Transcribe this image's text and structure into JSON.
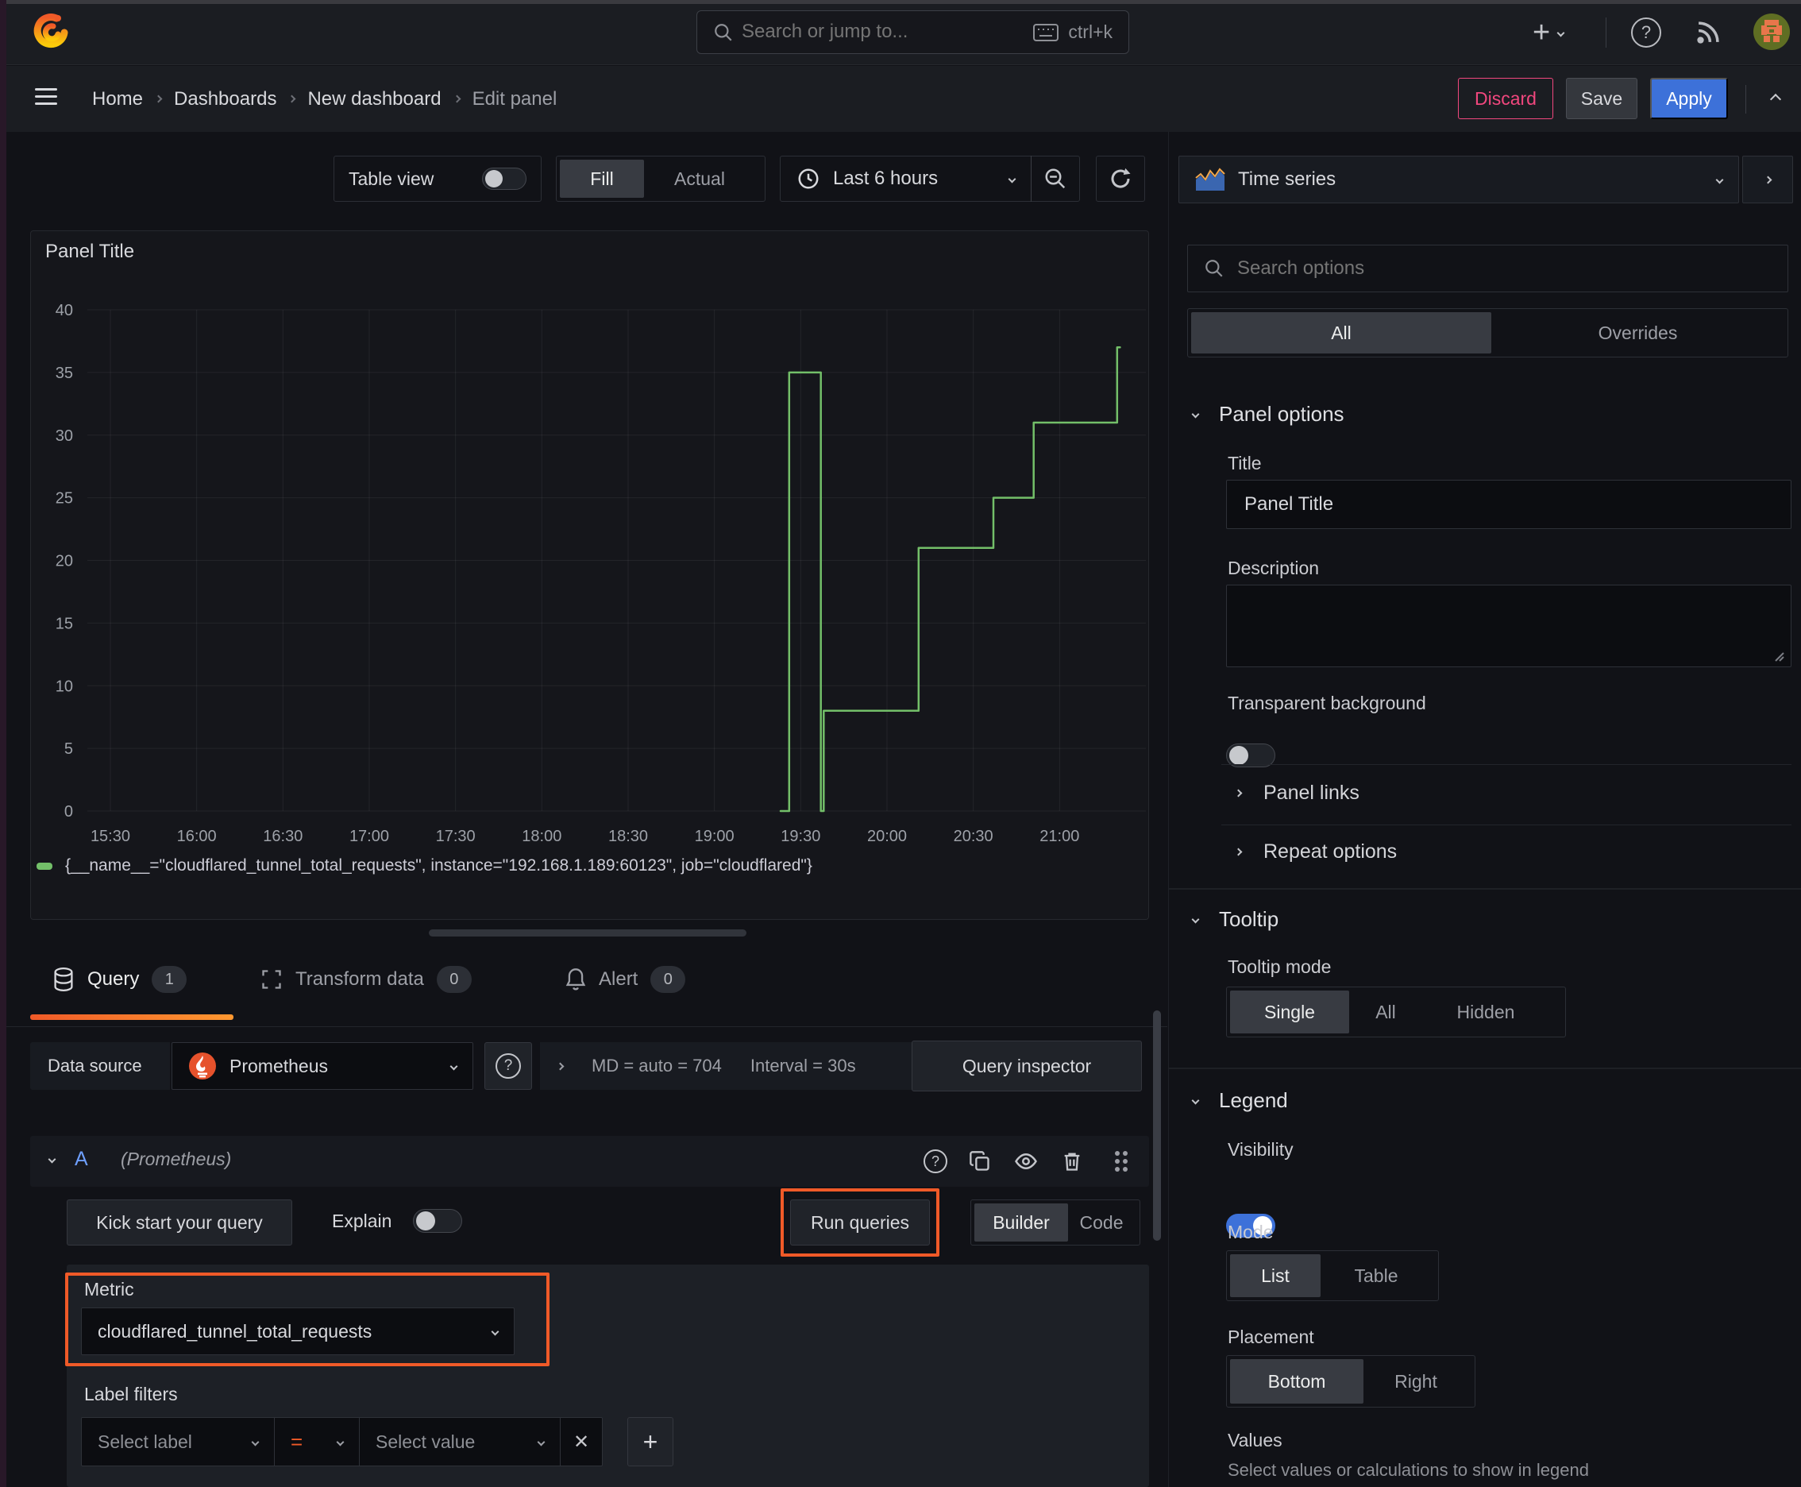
{
  "topnav": {
    "search_placeholder": "Search or jump to...",
    "shortcut": "ctrl+k"
  },
  "breadcrumb": {
    "items": [
      "Home",
      "Dashboards",
      "New dashboard",
      "Edit panel"
    ],
    "discard": "Discard",
    "save": "Save",
    "apply": "Apply"
  },
  "toolbar": {
    "table_view": "Table view",
    "fill": "Fill",
    "actual": "Actual",
    "time_range": "Last 6 hours"
  },
  "panel": {
    "title": "Panel Title"
  },
  "chart_data": {
    "type": "line",
    "title": "Panel Title",
    "x_ticks": [
      "15:30",
      "16:00",
      "16:30",
      "17:00",
      "17:30",
      "18:00",
      "18:30",
      "19:00",
      "19:30",
      "20:00",
      "20:30",
      "21:00"
    ],
    "y_ticks": [
      0,
      5,
      10,
      15,
      20,
      25,
      30,
      35,
      40
    ],
    "ylim": [
      0,
      40
    ],
    "x_domain_minutes_from_1530": [
      -8,
      360
    ],
    "grid": true,
    "legend_position": "bottom",
    "series": [
      {
        "name": "{__name__=\"cloudflared_tunnel_total_requests\", instance=\"192.168.1.189:60123\", job=\"cloudflared\"}",
        "color": "#73bf69",
        "points": [
          [
            "19:23",
            0
          ],
          [
            "19:26",
            0
          ],
          [
            "19:26",
            35
          ],
          [
            "19:37",
            35
          ],
          [
            "19:37",
            0
          ],
          [
            "19:38",
            0
          ],
          [
            "19:38",
            8
          ],
          [
            "20:11",
            8
          ],
          [
            "20:11",
            21
          ],
          [
            "20:37",
            21
          ],
          [
            "20:37",
            25
          ],
          [
            "20:51",
            25
          ],
          [
            "20:51",
            31
          ],
          [
            "21:20",
            31
          ],
          [
            "21:20",
            37
          ],
          [
            "21:21",
            37
          ]
        ]
      }
    ]
  },
  "tabs": {
    "query": "Query",
    "query_count": "1",
    "transform": "Transform data",
    "transform_count": "0",
    "alert": "Alert",
    "alert_count": "0"
  },
  "datasource": {
    "label": "Data source",
    "name": "Prometheus",
    "md": "MD = auto = 704",
    "interval": "Interval = 30s",
    "inspector": "Query inspector"
  },
  "query_editor": {
    "ref_id": "A",
    "ds_hint": "(Prometheus)",
    "kick_start": "Kick start your query",
    "explain": "Explain",
    "run_queries": "Run queries",
    "builder": "Builder",
    "code": "Code",
    "metric_label": "Metric",
    "metric_value": "cloudflared_tunnel_total_requests",
    "label_filters_label": "Label filters",
    "select_label_placeholder": "Select label",
    "operator": "=",
    "select_value_placeholder": "Select value"
  },
  "sidebar": {
    "visualization": "Time series",
    "search_placeholder": "Search options",
    "tabs": [
      "All",
      "Overrides"
    ],
    "panel_options": {
      "header": "Panel options",
      "title_label": "Title",
      "title_value": "Panel Title",
      "description_label": "Description",
      "transparent_label": "Transparent background"
    },
    "collapsed": [
      "Panel links",
      "Repeat options"
    ],
    "tooltip": {
      "header": "Tooltip",
      "mode_label": "Tooltip mode",
      "modes": [
        "Single",
        "All",
        "Hidden"
      ]
    },
    "legend": {
      "header": "Legend",
      "visibility_label": "Visibility",
      "mode_label": "Mode",
      "modes": [
        "List",
        "Table"
      ],
      "placement_label": "Placement",
      "placements": [
        "Bottom",
        "Right"
      ],
      "values_label": "Values",
      "values_hint": "Select values or calculations to show in legend"
    }
  },
  "icons": {
    "plus": "+",
    "help_q": "?",
    "close_x": "✕"
  },
  "colors": {
    "accent_orange": "#f05a28",
    "series_green": "#73bf69",
    "primary_blue": "#3d71d9",
    "danger_pink": "#f1477e"
  }
}
